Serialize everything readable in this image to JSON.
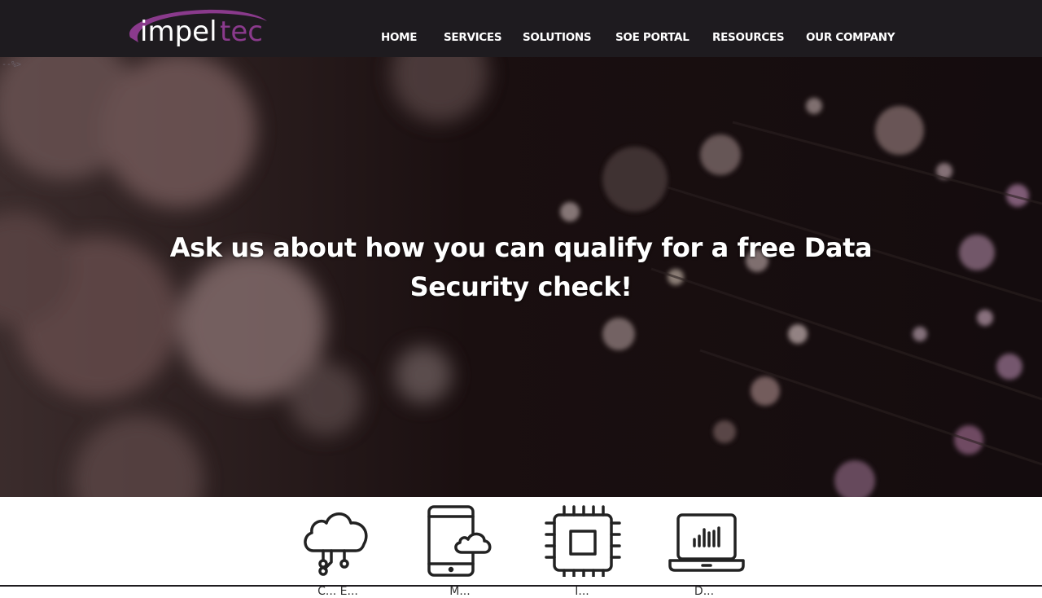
{
  "brand": {
    "logo_part1": "impel",
    "logo_part2": "tec",
    "logo_accent": "#8a3a8c"
  },
  "nav": {
    "items": [
      {
        "label": "HOME"
      },
      {
        "label": "SERVICES"
      },
      {
        "label": "SOLUTIONS"
      },
      {
        "label": "SOE PORTAL"
      },
      {
        "label": "RESOURCES"
      },
      {
        "label": "OUR COMPANY"
      }
    ]
  },
  "hero": {
    "stray_text": "--%>",
    "headline_line1": "Ask us about how you can qualify for a free Data",
    "headline_line2": "Security check!"
  },
  "features": [
    {
      "icon": "cloud-network-icon",
      "label": "C... E..."
    },
    {
      "icon": "mobile-cloud-icon",
      "label": "M..."
    },
    {
      "icon": "cpu-chip-icon",
      "label": "I..."
    },
    {
      "icon": "laptop-chart-icon",
      "label": "D..."
    }
  ],
  "colors": {
    "header_bg": "#1e1b1f",
    "accent_purple": "#8a3a8c",
    "icon_stroke": "#222222"
  }
}
